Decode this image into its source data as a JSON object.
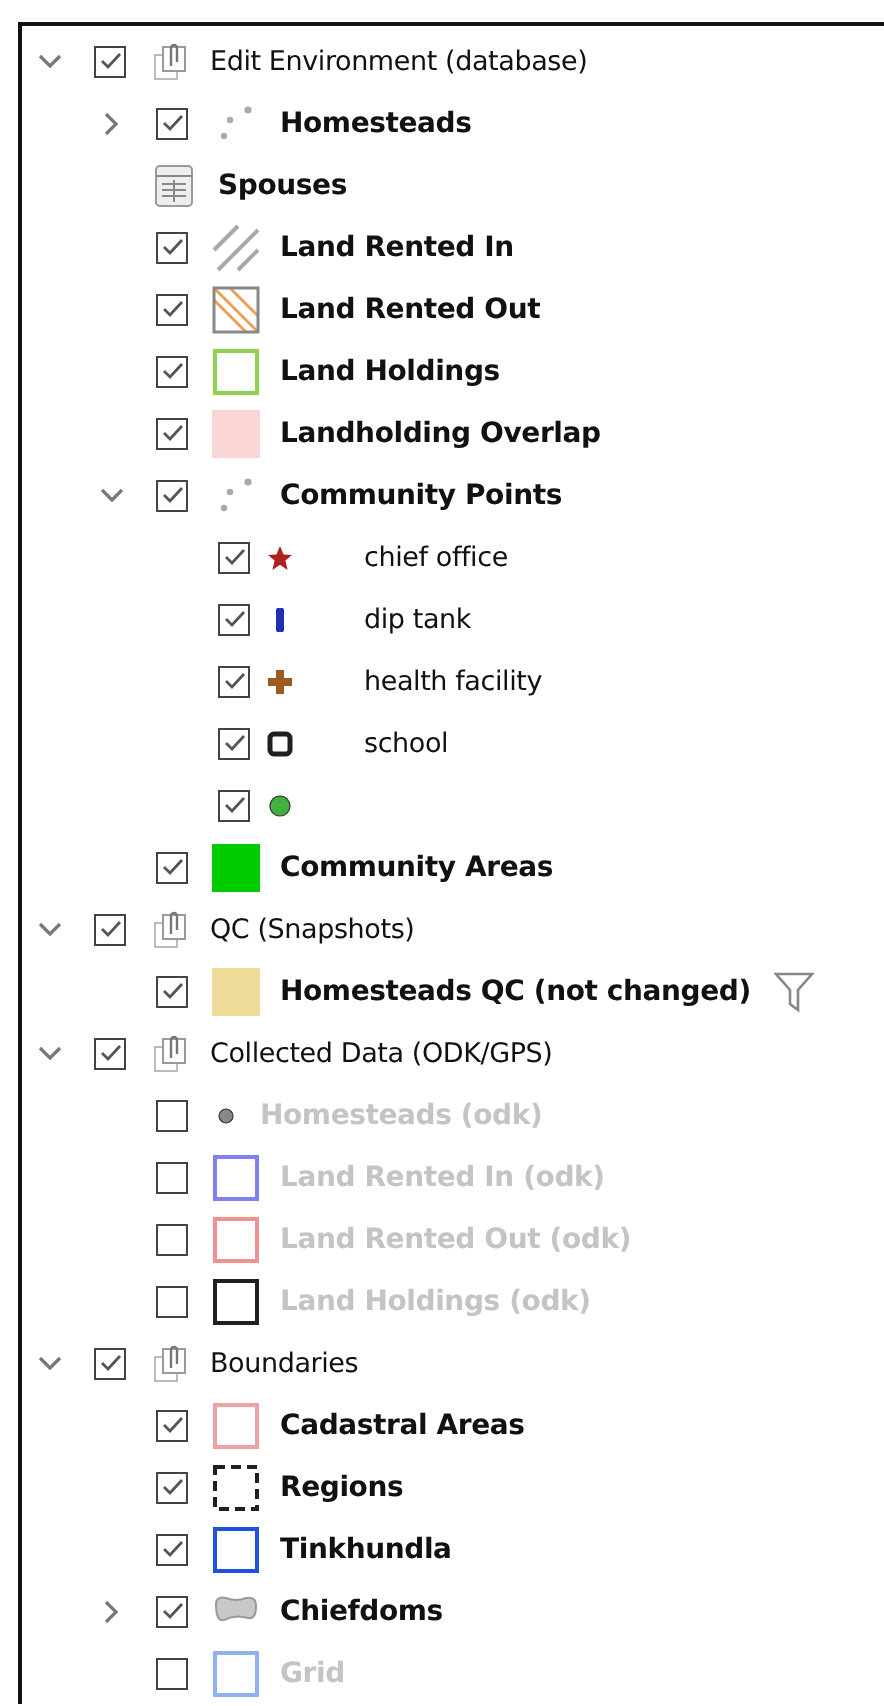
{
  "layer_tree": [
    {
      "kind": "group",
      "label": "Edit Environment (database)",
      "checked": true,
      "expanded": true,
      "children": [
        {
          "kind": "points",
          "label": "Homesteads",
          "checked": true,
          "expanded": false
        },
        {
          "kind": "table",
          "label": "Spouses"
        },
        {
          "kind": "hatch",
          "color": "#a8a8a8",
          "label": "Land Rented In",
          "checked": true
        },
        {
          "kind": "hatchbox",
          "color": "#f0a050",
          "label": "Land Rented Out",
          "checked": true
        },
        {
          "kind": "outline",
          "color": "#8fd050",
          "label": "Land Holdings",
          "checked": true
        },
        {
          "kind": "fill",
          "color": "#fad6d6",
          "label": "Landholding Overlap",
          "checked": true
        },
        {
          "kind": "points",
          "label": "Community Points",
          "checked": true,
          "expanded": true,
          "children": [
            {
              "kind": "star",
              "color": "#b02020",
              "label": "chief office",
              "checked": true
            },
            {
              "kind": "bar",
              "color": "#2030b0",
              "label": "dip tank",
              "checked": true
            },
            {
              "kind": "cross",
              "color": "#a05a20",
              "label": "health facility",
              "checked": true
            },
            {
              "kind": "square",
              "color": "#202020",
              "label": "school",
              "checked": true
            },
            {
              "kind": "dot",
              "color": "#40b040",
              "checked": true
            }
          ]
        },
        {
          "kind": "fill",
          "color": "#00cc00",
          "label": "Community Areas",
          "checked": true
        }
      ]
    },
    {
      "kind": "group",
      "label": "QC (Snapshots)",
      "checked": true,
      "expanded": true,
      "children": [
        {
          "kind": "fill",
          "color": "#f0dc9a",
          "label": "Homesteads QC (not changed)",
          "checked": true,
          "filtered": true
        }
      ]
    },
    {
      "kind": "group",
      "label": "Collected Data (ODK/GPS)",
      "checked": true,
      "expanded": true,
      "children": [
        {
          "kind": "dot",
          "color": "#888888",
          "label": "Homesteads (odk)",
          "checked": false
        },
        {
          "kind": "outline",
          "color": "#8080f0",
          "label": "Land Rented In (odk)",
          "checked": false
        },
        {
          "kind": "outline",
          "color": "#f09090",
          "label": "Land Rented Out (odk)",
          "checked": false
        },
        {
          "kind": "outline",
          "color": "#202020",
          "label": "Land Holdings (odk)",
          "checked": false
        }
      ]
    },
    {
      "kind": "group",
      "label": "Boundaries",
      "checked": true,
      "expanded": true,
      "children": [
        {
          "kind": "outline",
          "color": "#f0a0a0",
          "label": "Cadastral Areas",
          "checked": true
        },
        {
          "kind": "dashed",
          "color": "#202020",
          "label": "Regions",
          "checked": true
        },
        {
          "kind": "outline",
          "color": "#2050e0",
          "label": "Tinkhundla",
          "checked": true
        },
        {
          "kind": "polygon",
          "color": "#c8c8c8",
          "label": "Chiefdoms",
          "checked": true,
          "expanded": false
        },
        {
          "kind": "outline",
          "color": "#90b0f0",
          "label": "Grid",
          "checked": false
        }
      ]
    }
  ]
}
